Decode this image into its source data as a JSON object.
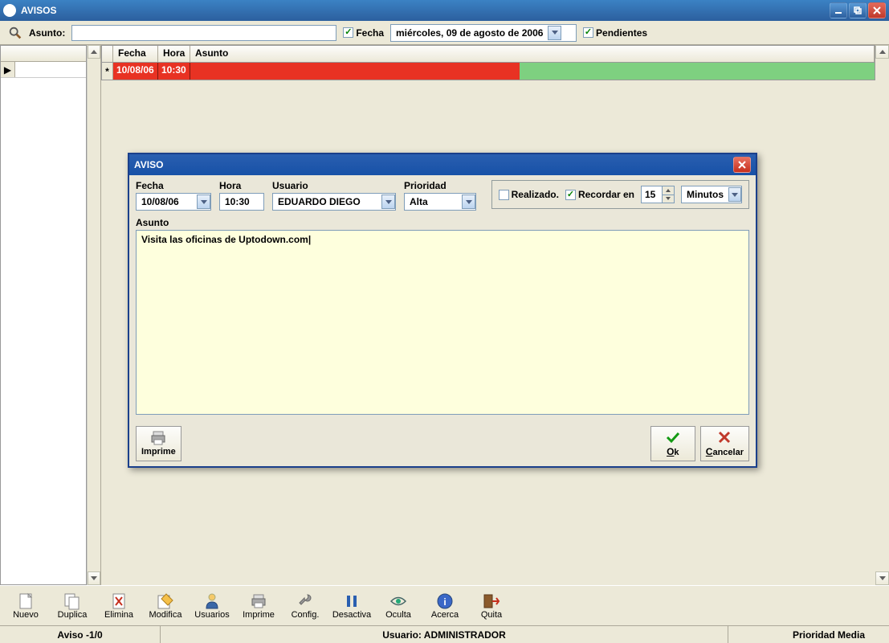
{
  "window": {
    "title": "AVISOS"
  },
  "filter": {
    "asunto_label": "Asunto:",
    "asunto_value": "",
    "fecha_chk_label": "Fecha",
    "fecha_value": "miércoles, 09 de   agosto   de 2006",
    "pendientes_label": "Pendientes"
  },
  "grid": {
    "headers": {
      "fecha": "Fecha",
      "hora": "Hora",
      "asunto": "Asunto"
    },
    "row": {
      "fecha": "10/08/06",
      "hora": "10:30"
    }
  },
  "dialog": {
    "title": "AVISO",
    "labels": {
      "fecha": "Fecha",
      "hora": "Hora",
      "usuario": "Usuario",
      "prioridad": "Prioridad",
      "realizado": "Realizado.",
      "recordar": "Recordar en",
      "minutos": "Minutos",
      "asunto": "Asunto"
    },
    "values": {
      "fecha": "10/08/06",
      "hora": "10:30",
      "usuario": "EDUARDO DIEGO",
      "prioridad": "Alta",
      "recordar_num": "15",
      "asunto_text": "Visita las oficinas de Uptodown.com|"
    },
    "buttons": {
      "imprime": "Imprime",
      "ok": "Ok",
      "cancelar": "Cancelar"
    }
  },
  "toolbar": {
    "nuevo": "Nuevo",
    "duplica": "Duplica",
    "elimina": "Elimina",
    "modifica": "Modifica",
    "usuarios": "Usuarios",
    "imprime": "Imprime",
    "config": "Config.",
    "desactiva": "Desactiva",
    "oculta": "Oculta",
    "acerca": "Acerca",
    "quita": "Quita"
  },
  "status": {
    "left": "Aviso -1/0",
    "center": "Usuario: ADMINISTRADOR",
    "right": "Prioridad Media"
  }
}
